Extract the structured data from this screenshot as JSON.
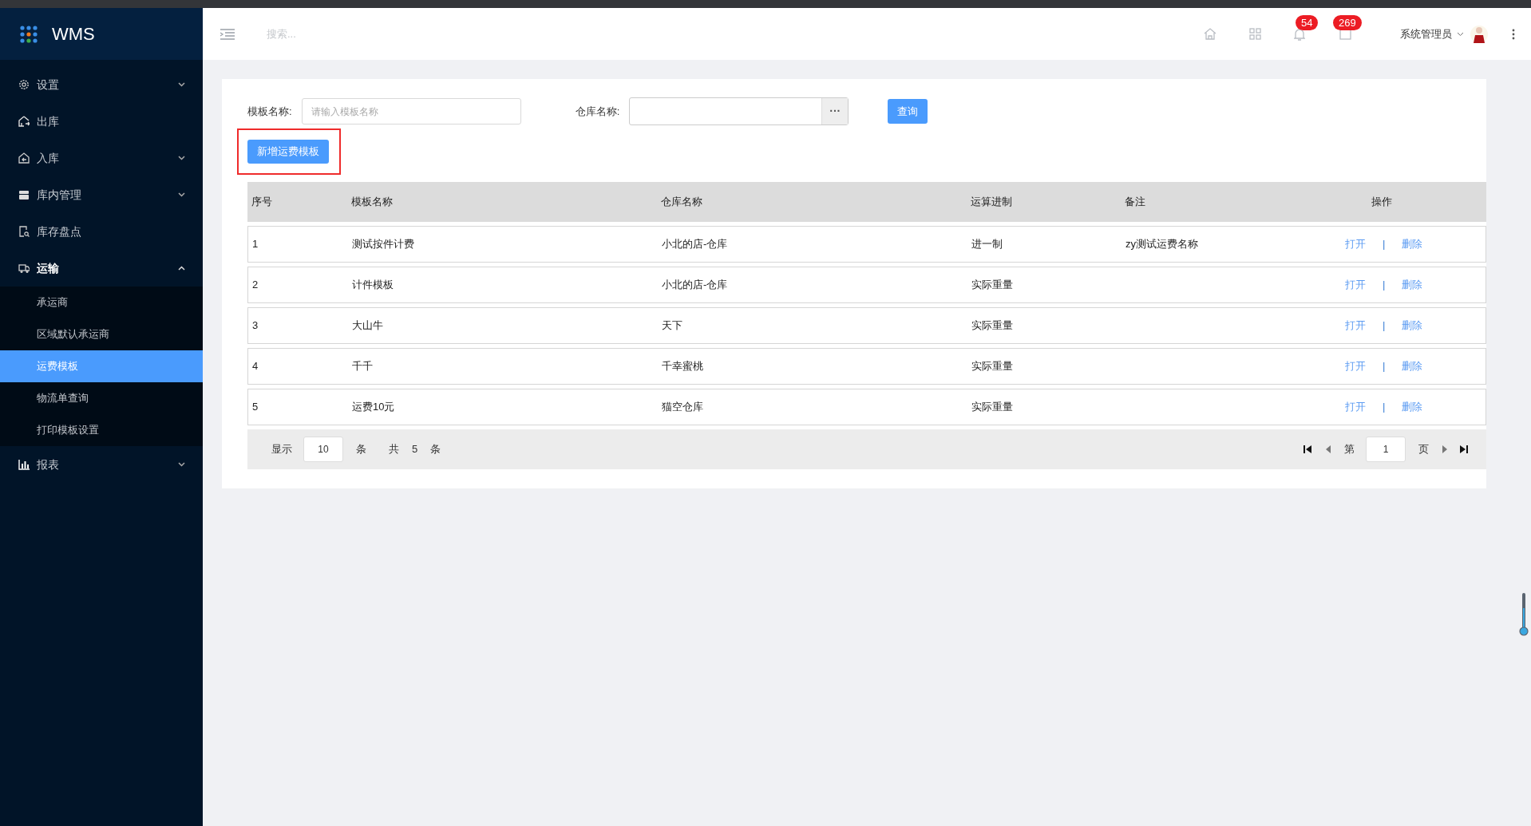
{
  "app": {
    "title": "WMS"
  },
  "sidebar": {
    "items": [
      {
        "label": "设置",
        "kind": "group",
        "expanded": false
      },
      {
        "label": "出库",
        "kind": "link",
        "expanded": false
      },
      {
        "label": "入库",
        "kind": "group",
        "expanded": false
      },
      {
        "label": "库内管理",
        "kind": "group",
        "expanded": false
      },
      {
        "label": "库存盘点",
        "kind": "link",
        "expanded": false
      },
      {
        "label": "运输",
        "kind": "group",
        "expanded": true,
        "children": [
          {
            "label": "承运商",
            "selected": false
          },
          {
            "label": "区域默认承运商",
            "selected": false
          },
          {
            "label": "运费模板",
            "selected": true
          },
          {
            "label": "物流单查询",
            "selected": false
          },
          {
            "label": "打印模板设置",
            "selected": false
          }
        ]
      },
      {
        "label": "报表",
        "kind": "group",
        "expanded": false
      }
    ]
  },
  "header": {
    "search": {
      "placeholder": "搜索..."
    },
    "notifications": "54",
    "messages": "269",
    "user": "系统管理员"
  },
  "filters": [
    {
      "label": "模板名称:",
      "kind": "text",
      "placeholder": "请输入模板名称"
    },
    {
      "label": "仓库名称:",
      "kind": "picker",
      "button": "···"
    }
  ],
  "query_button": "查询",
  "add_button": {
    "label": "新增运费模板",
    "highlighted": true
  },
  "table": {
    "columns": [
      "序号",
      "模板名称",
      "仓库名称",
      "运算进制",
      "备注",
      "操作"
    ],
    "rows": [
      {
        "cells": [
          "1",
          "测试按件计费",
          "小北的店-仓库",
          "进一制",
          "zy测试运费名称"
        ],
        "actions": [
          "打开",
          "|",
          "删除"
        ]
      },
      {
        "cells": [
          "2",
          "计件模板",
          "小北的店-仓库",
          "实际重量",
          ""
        ],
        "actions": [
          "打开",
          "|",
          "删除"
        ]
      },
      {
        "cells": [
          "3",
          "大山牛",
          "天下",
          "实际重量",
          ""
        ],
        "actions": [
          "打开",
          "|",
          "删除"
        ]
      },
      {
        "cells": [
          "4",
          "千千",
          "千幸蜜桃",
          "实际重量",
          ""
        ],
        "actions": [
          "打开",
          "|",
          "删除"
        ]
      },
      {
        "cells": [
          "5",
          "运费10元",
          "猫空仓库",
          "实际重量",
          ""
        ],
        "actions": [
          "打开",
          "|",
          "删除"
        ]
      }
    ]
  },
  "pagination": {
    "show_label": "显示",
    "page_size": "10",
    "unit": "条",
    "total_label": "共",
    "total": "5",
    "total_unit": "条",
    "page_label": "第",
    "page": "1",
    "page_unit": "页"
  }
}
